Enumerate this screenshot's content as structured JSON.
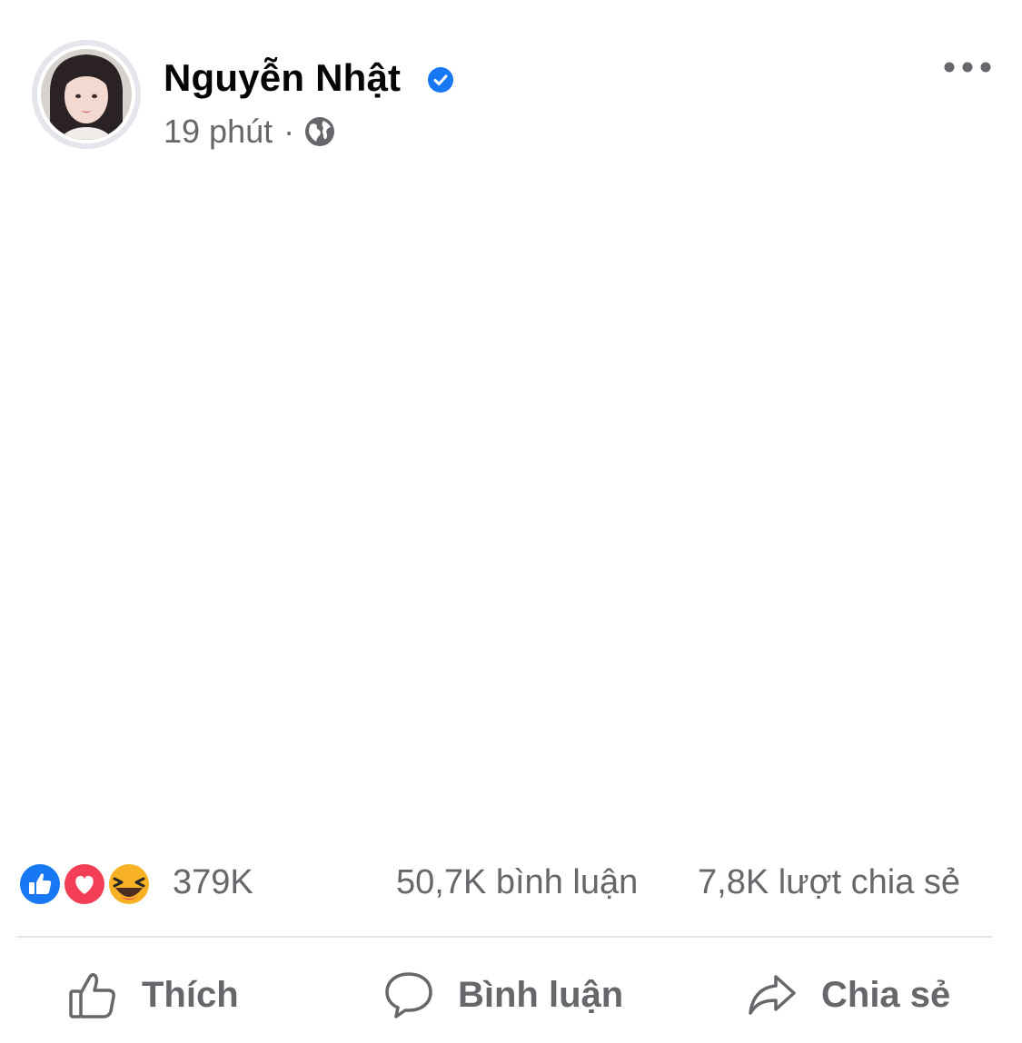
{
  "post": {
    "author": "Nguyễn Nhật",
    "time": "19 phút",
    "separator": "·",
    "privacy_icon": "globe-icon",
    "verified_icon": "verified-badge-icon",
    "more_icon": "more-options-icon"
  },
  "stats": {
    "reaction_icons": [
      "like-reaction-icon",
      "love-reaction-icon",
      "haha-reaction-icon"
    ],
    "reactions": "379K",
    "comments": "50,7K bình luận",
    "shares": "7,8K lượt chia sẻ"
  },
  "actions": {
    "like": "Thích",
    "comment": "Bình luận",
    "share": "Chia sẻ"
  },
  "colors": {
    "verified_blue": "#1877f2",
    "love_red": "#f33e58",
    "haha_yellow": "#f7b125",
    "secondary_text": "#65676b",
    "divider": "#e4e6eb"
  }
}
